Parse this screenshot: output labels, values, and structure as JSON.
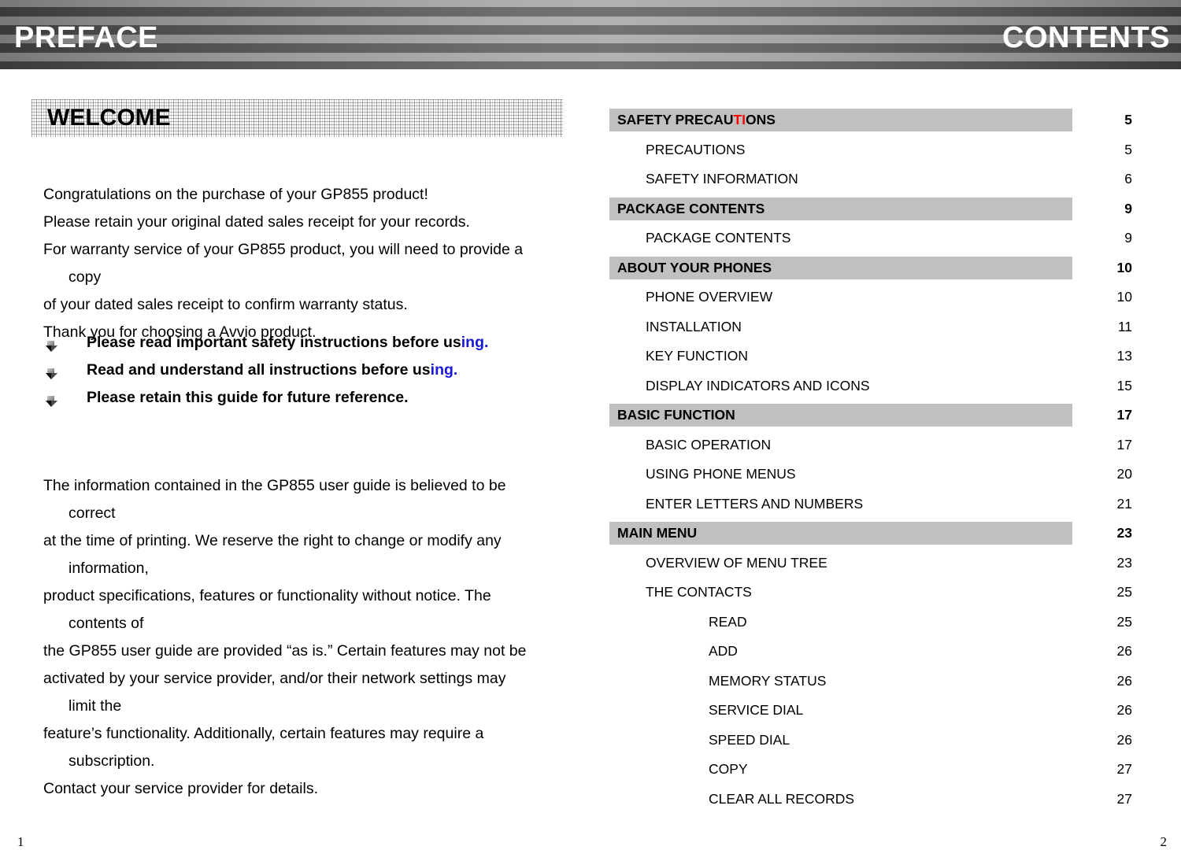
{
  "header": {
    "left_title": "PREFACE",
    "right_title": "CONTENTS"
  },
  "left_page": {
    "section_title": "WELCOME",
    "intro_lines": [
      {
        "text": "Congratulations on the purchase of your GP855 product!",
        "continuation": false
      },
      {
        "text": "Please retain your original dated sales receipt for your records.",
        "continuation": false
      },
      {
        "text": "For warranty service of your GP855 product, you will need to provide a",
        "continuation": false
      },
      {
        "text": "copy",
        "continuation": true
      },
      {
        "text": "of your dated sales receipt to confirm warranty status.",
        "continuation": false
      },
      {
        "text": "Thank you for choosing a Avvio product.",
        "continuation": false
      }
    ],
    "bullets": [
      {
        "black_text": "Please read important safety instructions before us",
        "blue_text": "ing."
      },
      {
        "black_text": "Read and understand all instructions before us",
        "blue_text": "ing."
      },
      {
        "black_text": "Please retain this guide for future reference.",
        "blue_text": ""
      }
    ],
    "notice_lines": [
      {
        "text": "The information contained in the GP855 user guide is believed to be",
        "continuation": false
      },
      {
        "text": "correct",
        "continuation": true
      },
      {
        "text": "at the time of printing. We reserve the right to change or modify any",
        "continuation": false
      },
      {
        "text": "information,",
        "continuation": true
      },
      {
        "text": "product specifications, features or functionality without notice. The",
        "continuation": false
      },
      {
        "text": "contents of",
        "continuation": true
      },
      {
        "text": "the GP855 user guide are provided “as is.” Certain features may not be",
        "continuation": false
      },
      {
        "text": "activated by your service provider, and/or their network settings may",
        "continuation": false
      },
      {
        "text": "limit the",
        "continuation": true
      },
      {
        "text": "feature’s functionality. Additionally, certain features may require a",
        "continuation": false
      },
      {
        "text": "subscription.",
        "continuation": true
      },
      {
        "text": "Contact your service provider for details.",
        "continuation": false
      }
    ],
    "folio": "1"
  },
  "right_page": {
    "toc": [
      {
        "label": "SAFETY PRECAUTIONS",
        "label_pre": "SAFETY PRECAU",
        "label_accent": "TI",
        "label_post": "ONS",
        "page": "5",
        "level": 0
      },
      {
        "label": "PRECAUTIONS",
        "page": "5",
        "level": 1
      },
      {
        "label": "SAFETY INFORMATION",
        "page": "6",
        "level": 1
      },
      {
        "label": "PACKAGE CONTENTS",
        "page": "9",
        "level": 0
      },
      {
        "label": "PACKAGE CONTENTS",
        "page": "9",
        "level": 1
      },
      {
        "label": "ABOUT YOUR PHONES",
        "page": "10",
        "level": 0
      },
      {
        "label": "PHONE OVERVIEW",
        "page": "10",
        "level": 1
      },
      {
        "label": "INSTALLATION",
        "page": "11",
        "level": 1
      },
      {
        "label": "KEY FUNCTION",
        "page": "13",
        "level": 1
      },
      {
        "label": "DISPLAY INDICATORS AND ICONS",
        "page": "15",
        "level": 1
      },
      {
        "label": "BASIC FUNCTION",
        "page": "17",
        "level": 0
      },
      {
        "label": "BASIC OPERATION",
        "page": "17",
        "level": 1
      },
      {
        "label": "USING PHONE MENUS",
        "page": "20",
        "level": 1
      },
      {
        "label": "ENTER LETTERS AND NUMBERS",
        "page": "21",
        "level": 1
      },
      {
        "label": "MAIN MENU",
        "page": "23",
        "level": 0
      },
      {
        "label": "OVERVIEW OF MENU TREE",
        "page": "23",
        "level": 1
      },
      {
        "label": "THE CONTACTS",
        "page": "25",
        "level": 1
      },
      {
        "label": "READ",
        "page": "25",
        "level": 2
      },
      {
        "label": "ADD",
        "page": "26",
        "level": 2
      },
      {
        "label": "MEMORY STATUS",
        "page": "26",
        "level": 2
      },
      {
        "label": "SERVICE DIAL",
        "page": "26",
        "level": 2
      },
      {
        "label": "SPEED DIAL",
        "page": "26",
        "level": 2
      },
      {
        "label": "COPY",
        "page": "27",
        "level": 2
      },
      {
        "label": "CLEAR ALL RECORDS",
        "page": "27",
        "level": 2
      }
    ],
    "folio": "2"
  },
  "colors": {
    "stripe_dark": "#4c4c4c",
    "stripe_light": "#a0a0a0",
    "toc_bar": "#c0c0c0",
    "accent_red": "#ff0000",
    "accent_blue": "#1a18d8"
  }
}
